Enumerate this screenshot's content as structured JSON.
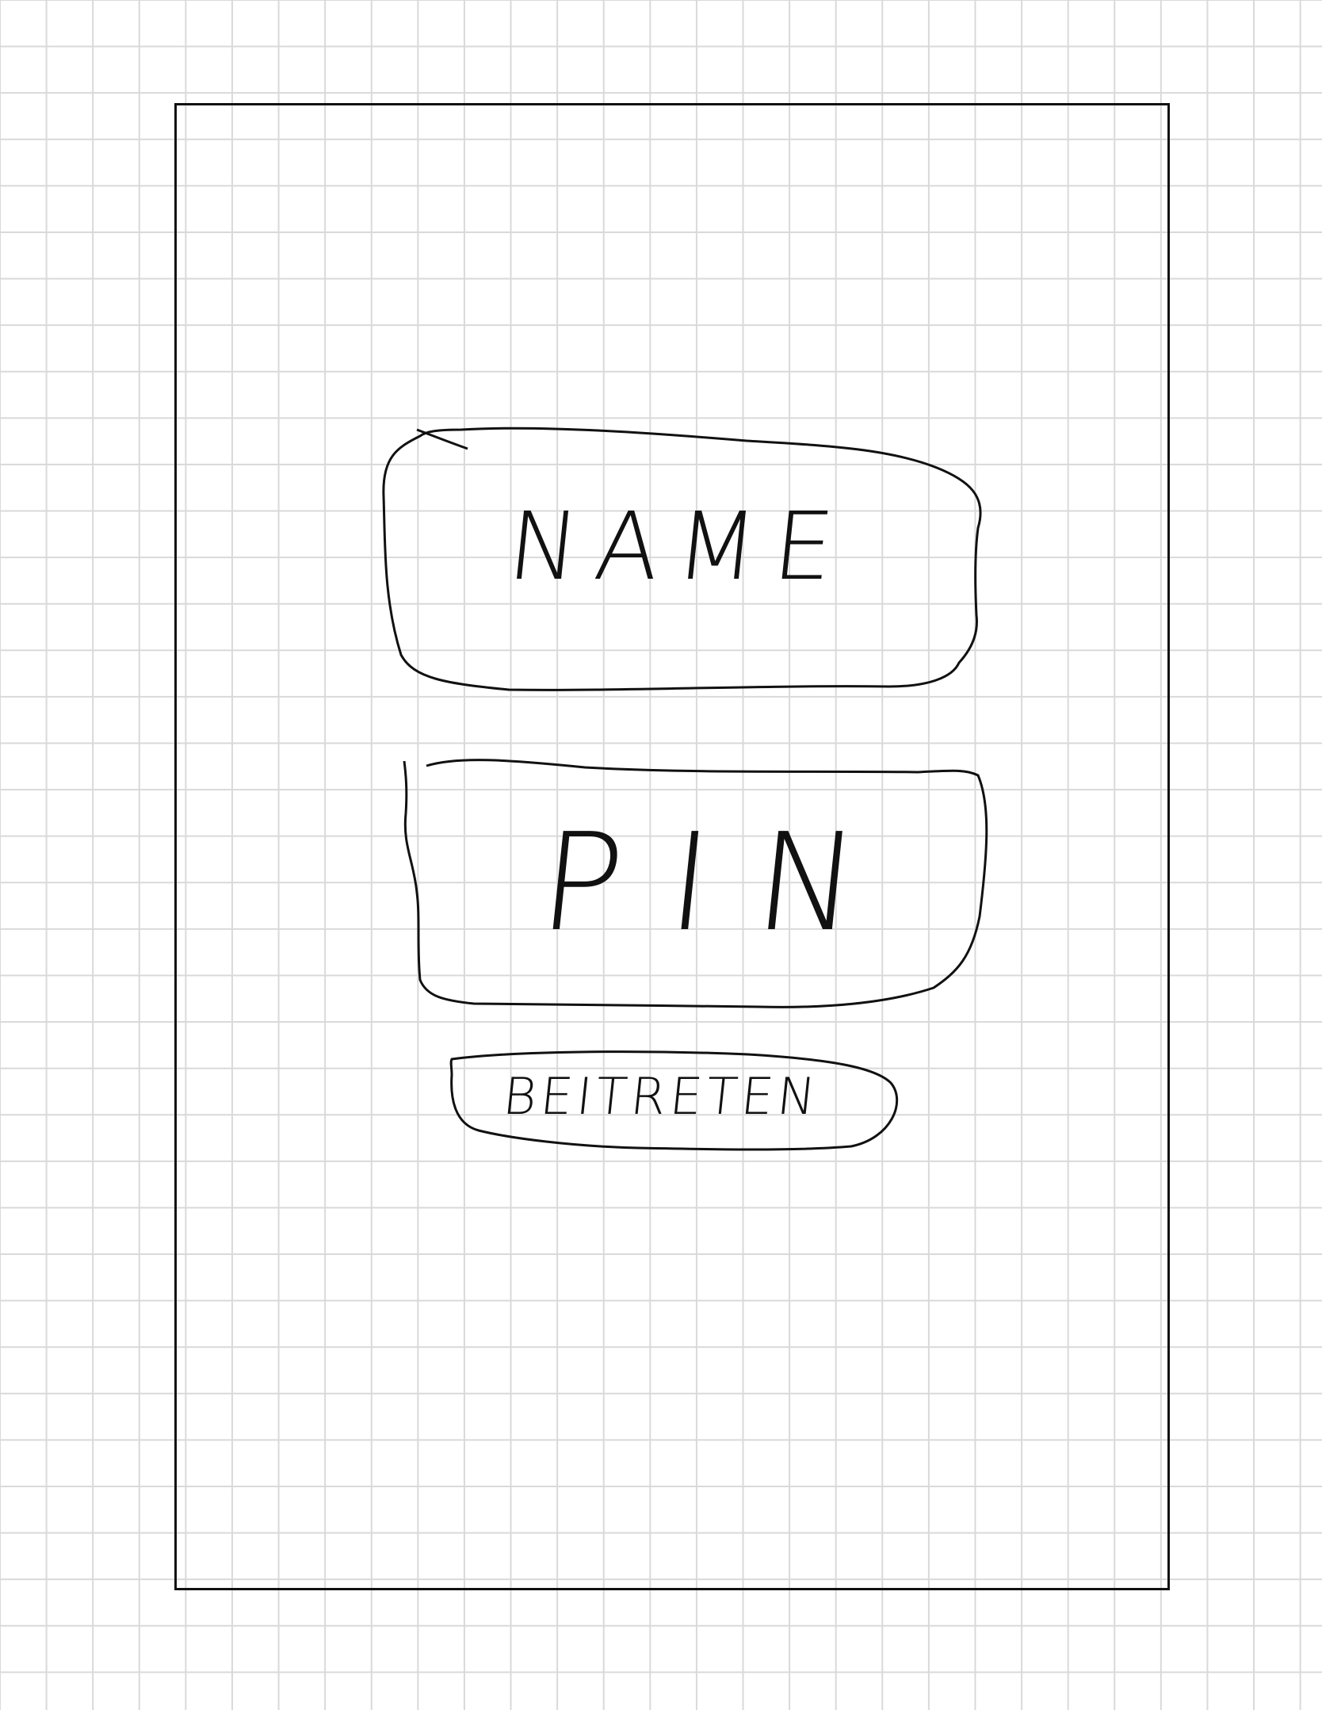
{
  "form": {
    "name_field": {
      "placeholder": "NAME"
    },
    "pin_field": {
      "placeholder": "PIN"
    },
    "join_button": {
      "label": "BEITRETEN"
    }
  },
  "colors": {
    "background": "#ffffff",
    "grid": "#d9d9d9",
    "ink": "#111111"
  }
}
